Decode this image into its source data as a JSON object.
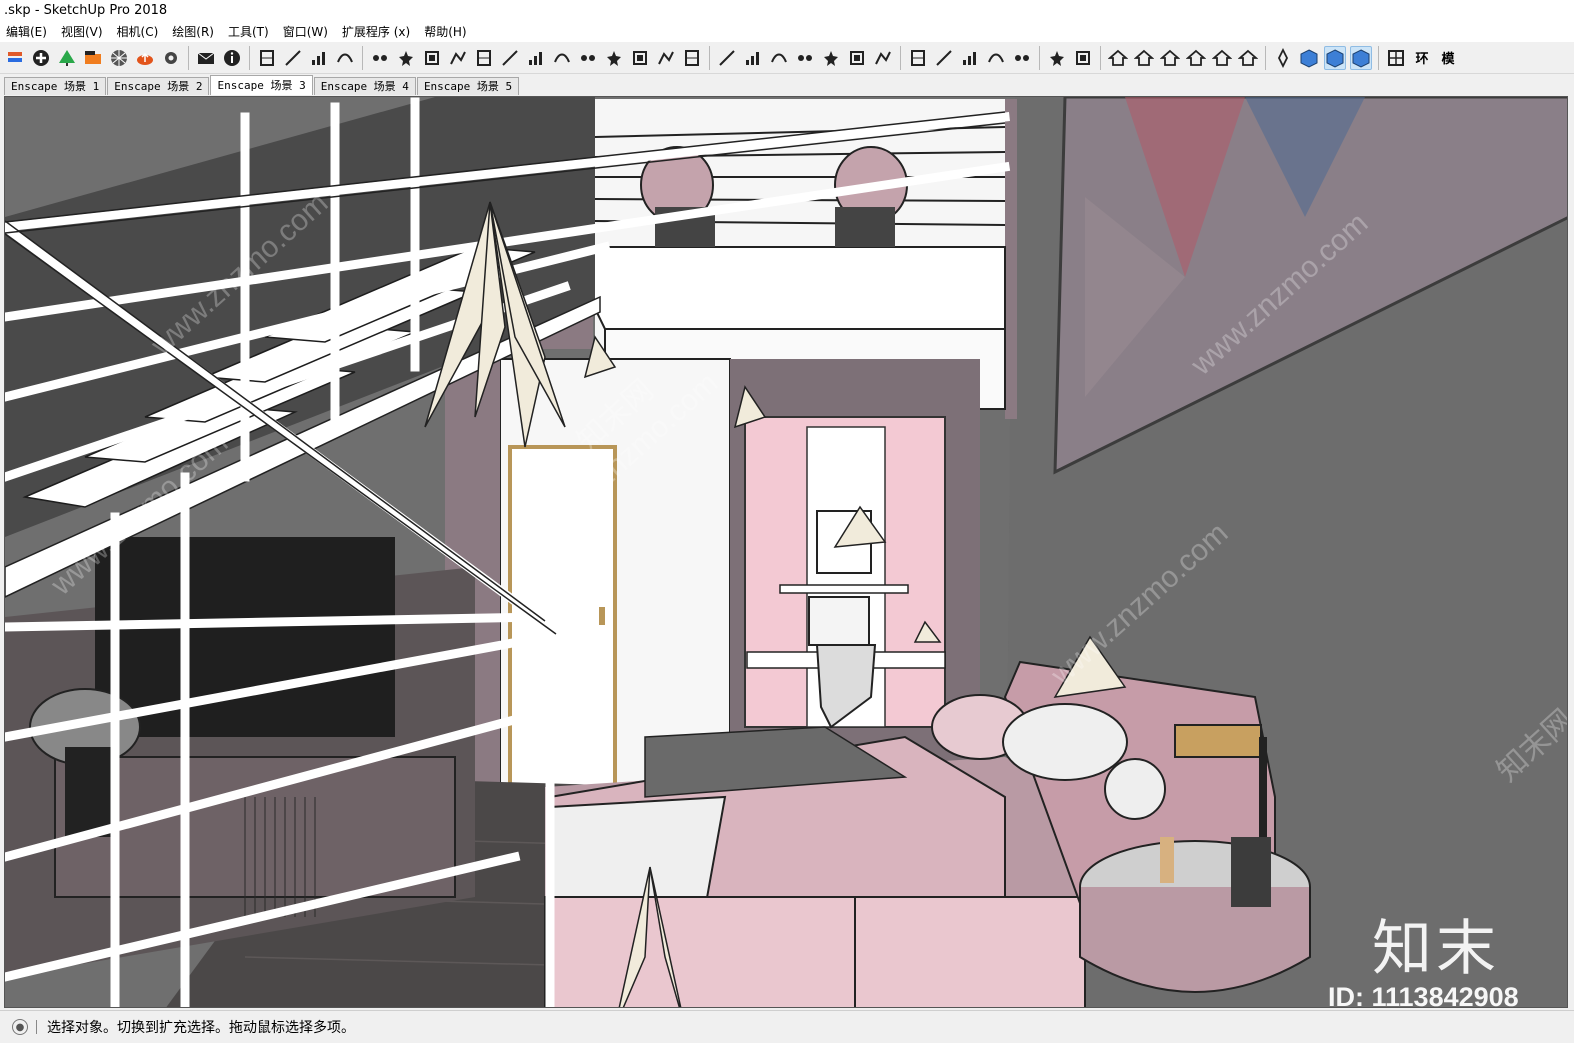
{
  "window": {
    "title": ".skp - SketchUp Pro 2018"
  },
  "menu": [
    "编辑(E)",
    "视图(V)",
    "相机(C)",
    "绘图(R)",
    "工具(T)",
    "窗口(W)",
    "扩展程序 (x)",
    "帮助(H)"
  ],
  "toolbar": {
    "icons": [
      "section-plane-icon",
      "add-icon",
      "tree-icon",
      "paint-icon",
      "grid-sphere-icon",
      "cloud-icon",
      "settings-icon",
      "mail-icon",
      "info-icon",
      "stairs-icon",
      "door-icon",
      "line-icon",
      "bars-icon",
      "tool-a-icon",
      "tool-b-icon",
      "tool-c-icon",
      "tool-d-icon",
      "tool-e-icon",
      "tool-f-icon",
      "tool-g-icon",
      "tool-h-icon",
      "tool-i-icon",
      "tool-j-icon",
      "tool-k-icon",
      "tool-l-icon",
      "tool-m-icon",
      "arc-icon",
      "chain-icon",
      "curve-icon",
      "spiral-icon",
      "pen-icon",
      "comb-icon",
      "column-icon",
      "triangle-icon",
      "dots-icon",
      "book-icon",
      "figure-icon",
      "brush-icon",
      "sticker-a-icon",
      "sticker-b-icon",
      "house-a-icon",
      "house-b-icon",
      "home-icon",
      "house-c-icon",
      "house-d-icon",
      "house-e-icon",
      "compass-icon",
      "cube-icon",
      "cube-active-icon",
      "cube-blue-icon",
      "grid-icon"
    ],
    "text_buttons": [
      "环",
      "模"
    ]
  },
  "scene_tabs": [
    "Enscape 场景 1",
    "Enscape 场景 2",
    "Enscape 场景 3",
    "Enscape 场景 4",
    "Enscape 场景 5"
  ],
  "active_scene_index": 2,
  "status": {
    "text": "选择对象。切换到扩充选择。拖动鼠标选择多项。"
  },
  "watermark": {
    "brand": "知末",
    "id": "ID: 1113842908",
    "site_text": "www.znzmo.com",
    "site_text_cn": "知末网"
  }
}
